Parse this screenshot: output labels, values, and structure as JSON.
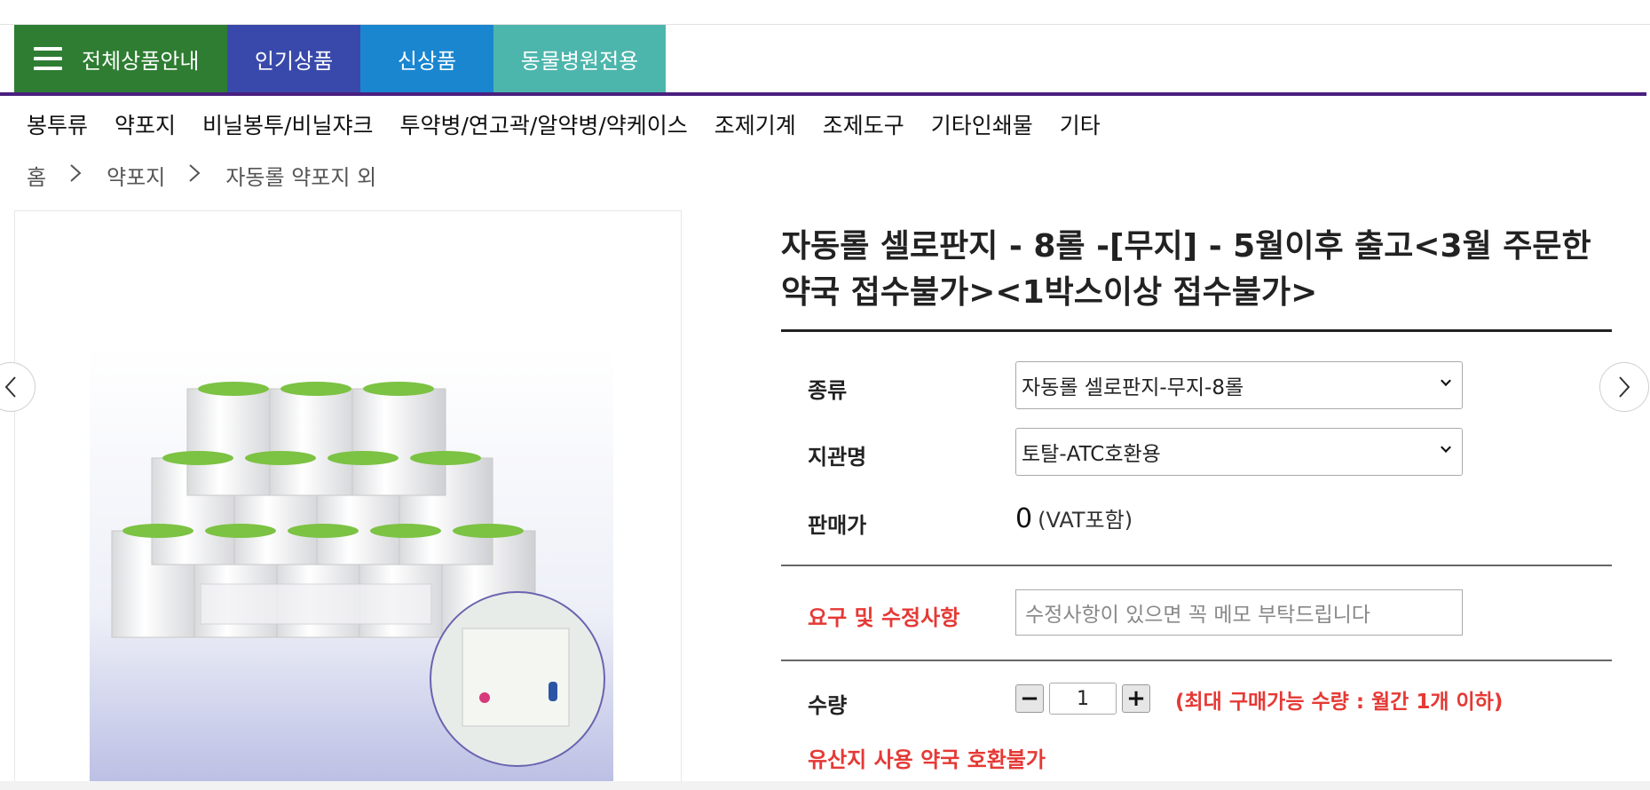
{
  "main_nav": {
    "all_products": "전체상품안내",
    "popular": "인기상품",
    "new": "신상품",
    "vet_only": "동물병원전용"
  },
  "category_menu": [
    "봉투류",
    "약포지",
    "비닐봉투/비닐쟈크",
    "투약병/연고곽/알약병/약케이스",
    "조제기계",
    "조제도구",
    "기타인쇄물",
    "기타"
  ],
  "breadcrumb": {
    "home": "홈",
    "level1": "약포지",
    "level2": "자동롤 약포지 외"
  },
  "product": {
    "title": "자동롤 셀로판지 - 8롤 -[무지] - 5월이후 출고<3월 주문한약국 접수불가><1박스이상 접수불가>",
    "type_label": "종류",
    "type_value": "자동롤 셀로판지-무지-8롤",
    "tube_label": "지관명",
    "tube_value": "토탈-ATC호환용",
    "price_label": "판매가",
    "price_value": "0",
    "price_note": "(VAT포함)",
    "request_label": "요구 및 수정사항",
    "request_placeholder": "수정사항이 있으면 꼭 메모 부탁드립니다",
    "qty_label": "수량",
    "qty_value": "1",
    "qty_minus": "−",
    "qty_plus": "+",
    "qty_note": "(최대 구매가능 수량 : 월간 1개 이하)",
    "warning": "유산지 사용 약국 호환불가"
  },
  "carousel": {
    "prev": "‹",
    "next": "›"
  },
  "colors": {
    "nav_all": "#2e7d32",
    "nav_popular": "#3949ab",
    "nav_new": "#1a86d0",
    "nav_vet": "#4db6ac",
    "accent_bar": "#4a1f7e",
    "warning_red": "#e53935"
  }
}
